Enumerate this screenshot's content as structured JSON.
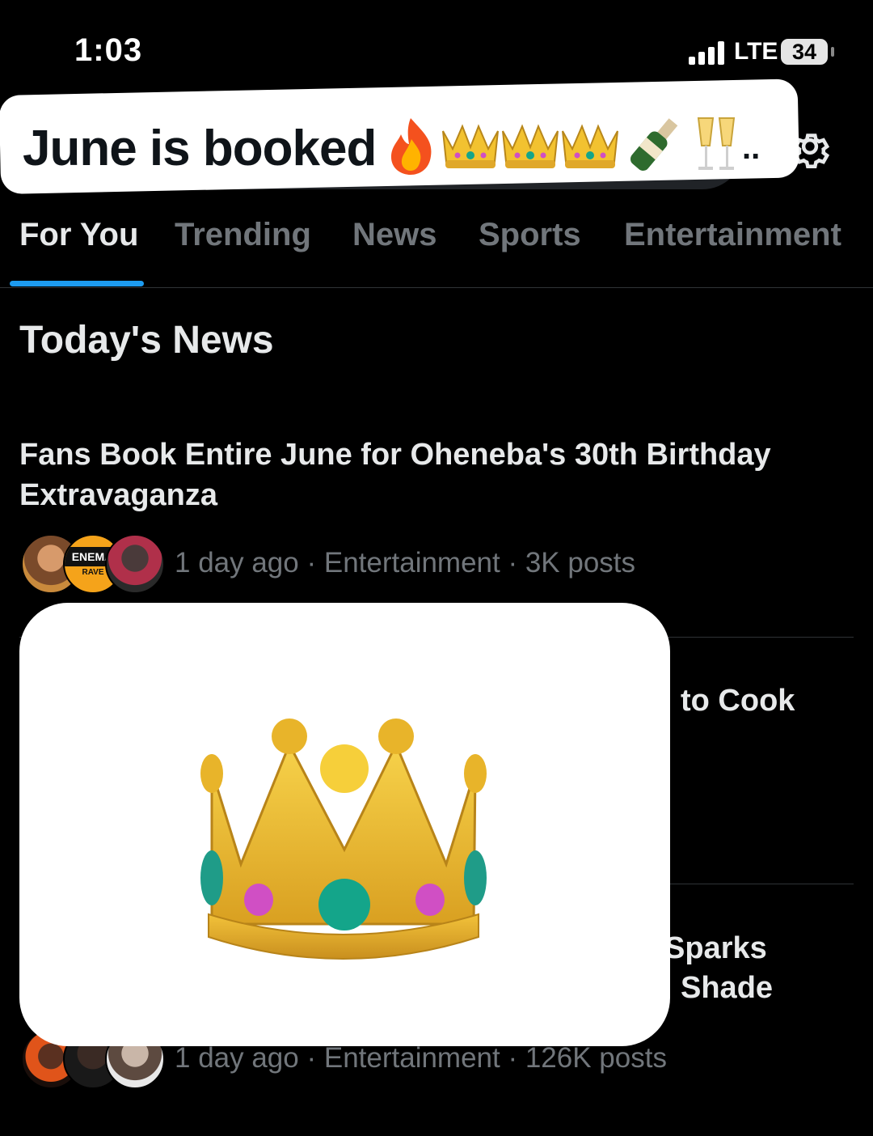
{
  "status_bar": {
    "time": "1:03",
    "network": "LTE",
    "battery": "34"
  },
  "banner": {
    "text": "June is booked",
    "emoji_names": [
      "fire-emoji",
      "crown-emoji",
      "crown-emoji",
      "crown-emoji",
      "champagne-emoji",
      "clinking-glasses-emoji"
    ],
    "ellipsis": ".."
  },
  "tabs": [
    {
      "label": "For You",
      "active": true
    },
    {
      "label": "Trending",
      "active": false
    },
    {
      "label": "News",
      "active": false
    },
    {
      "label": "Sports",
      "active": false
    },
    {
      "label": "Entertainment",
      "active": false
    }
  ],
  "section": {
    "title": "Today's News"
  },
  "stories": [
    {
      "headline": "Fans Book Entire June for Oheneba's 30th Birthday Extravaganza",
      "meta": "1 day ago · Entertainment · 3K posts",
      "avatar_badge": "ENEMA",
      "avatar_badge_sub": "RAVE"
    },
    {
      "headline_fragment": "to Cook"
    },
    {
      "headline_fragment_1": "Sparks",
      "headline_fragment_2": "Shade",
      "meta": "1 day ago · Entertainment · 126K posts"
    }
  ],
  "icons": {
    "settings": "gear-icon",
    "overlay": "crown-emoji"
  },
  "colors": {
    "accent": "#1d9bf0",
    "background": "#000000",
    "muted": "#71767b"
  }
}
